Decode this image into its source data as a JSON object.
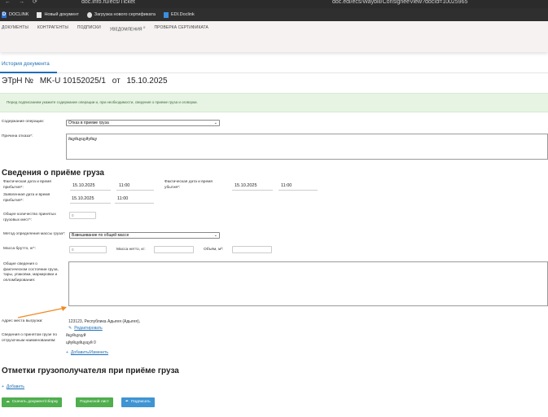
{
  "browser": {
    "url_left": "doc.info.ru/ecs/Ticket",
    "url_right": "doc.edi/ecs/Waybill/ConsigneeView?docId=10025965"
  },
  "bookmarks": [
    {
      "label": "DOCLINK",
      "icon": "doclink-icon"
    },
    {
      "label": "Новый документ",
      "icon": "document-icon"
    },
    {
      "label": "Загрузка нового сертификата",
      "icon": "certificate-icon"
    },
    {
      "label": "EDI.Doclink",
      "icon": "edi-icon"
    }
  ],
  "menu": {
    "documents": "ДОКУМЕНТЫ",
    "contractors": "КОНТРАГЕНТЫ",
    "signatures": "ПОДПИСКИ",
    "notifications": "УВЕДОМЛЕНИЯ",
    "notifications_count": "0",
    "certificate_check": "ПРОВЕРКА СЕРТИФИКАТА"
  },
  "tab": "История документа",
  "doc": {
    "type": "ЭТрН №",
    "number": "MK-U 10152025/1",
    "from": "от",
    "date": "15.10.2025"
  },
  "notice": "Перед подписанием укажите содержание операции и, при необходимости, сведения о приеме груза и оговорки.",
  "operation": {
    "label": "Содержание операции:",
    "value": "Отказ в приеме груза"
  },
  "reason": {
    "label": "Причина отказа*:",
    "value": "йцуйцуцуйуйцу"
  },
  "receipt": {
    "title": "Сведения о приёме груза",
    "actual_arrival_label": "Фактическая дата и время прибытия*:",
    "actual_arrival_date": "15.10.2025",
    "actual_arrival_time": "11:00",
    "actual_departure_label": "Фактическая дата и время убытия*:",
    "actual_departure_date": "15.10.2025",
    "actual_departure_time": "11:00",
    "declared_arrival_label": "Заявленная дата и время прибытия*:",
    "declared_arrival_date": "15.10.2025",
    "declared_arrival_time": "11:00",
    "places_label": "Общее количество принятых грузовых мест*:",
    "places_value": "0",
    "method_label": "Метод определения массы груза*:",
    "method_value": "Взвешивание по общей массе",
    "gross_label": "Масса брутто, кг*:",
    "gross_value": "0",
    "net_label": "Масса нетто, кг:",
    "volume_label": "Объём, м³:",
    "general_label": "Общие сведения о фактическом состоянии груза, тары, упаковки, маркировки и опломбирования:",
    "unload_label": "Адрес места выгрузки:",
    "unload_value": "123123, Республика Адыгея (Адыгея),",
    "edit_link": "Редактировать",
    "accepted_label": "Сведения о принятом грузе по отгрузочным наименованиям:",
    "accepted_line1": "йцуйцуцуй",
    "accepted_line2": "цйуйцуйцуцуй 0",
    "add_edit_link": "Добавить/Изменить"
  },
  "consignee": {
    "title": "Отметки грузополучателя при приёме груза",
    "add_link": "Добавить"
  },
  "buttons": {
    "download": "Скачать документ/сборку",
    "sheet": "Подписной лист",
    "sign": "Подписать"
  }
}
